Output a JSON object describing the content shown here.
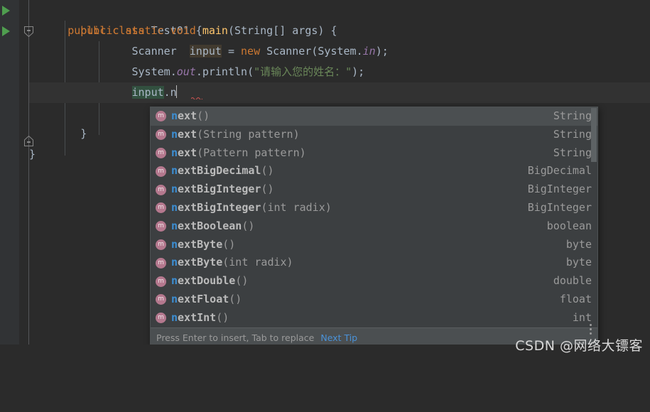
{
  "editor": {
    "lines": [
      {
        "indent": 0,
        "tokens": [
          {
            "t": "public ",
            "c": "kw"
          },
          {
            "t": "class ",
            "c": "kw"
          },
          {
            "t": "Test01",
            "c": "cls"
          },
          {
            "t": " {",
            "c": "punct"
          }
        ]
      },
      {
        "indent": 1,
        "tokens": [
          {
            "t": "public ",
            "c": "kw"
          },
          {
            "t": "static ",
            "c": "kw"
          },
          {
            "t": "void ",
            "c": "kw"
          },
          {
            "t": "main",
            "c": "fn"
          },
          {
            "t": "(",
            "c": "punct"
          },
          {
            "t": "String",
            "c": "cls"
          },
          {
            "t": "[] ",
            "c": "punct"
          },
          {
            "t": "args",
            "c": "ident"
          },
          {
            "t": ") {",
            "c": "punct"
          }
        ]
      },
      {
        "indent": 2,
        "tokens": [
          {
            "t": "Scanner ",
            "c": "cls"
          },
          {
            "t": " ",
            "c": "punct"
          },
          {
            "t": "input",
            "c": "ident hl-ident"
          },
          {
            "t": " = ",
            "c": "punct"
          },
          {
            "t": "new ",
            "c": "kw"
          },
          {
            "t": "Scanner",
            "c": "cls"
          },
          {
            "t": "(",
            "c": "punct"
          },
          {
            "t": "System",
            "c": "cls"
          },
          {
            "t": ".",
            "c": "punct"
          },
          {
            "t": "in",
            "c": "field"
          },
          {
            "t": ");",
            "c": "punct"
          }
        ]
      },
      {
        "indent": 2,
        "tokens": [
          {
            "t": "System",
            "c": "cls"
          },
          {
            "t": ".",
            "c": "punct"
          },
          {
            "t": "out",
            "c": "field"
          },
          {
            "t": ".",
            "c": "punct"
          },
          {
            "t": "println",
            "c": "ident"
          },
          {
            "t": "(",
            "c": "punct"
          },
          {
            "t": "\"请输入您的姓名：\"",
            "c": "str"
          },
          {
            "t": ");",
            "c": "punct"
          }
        ]
      },
      {
        "indent": 2,
        "tokens": [
          {
            "t": "input",
            "c": "ident hl-sel"
          },
          {
            "t": ".n",
            "c": "ident"
          }
        ]
      },
      {
        "indent": 0,
        "tokens": []
      },
      {
        "indent": 1,
        "tokens": [
          {
            "t": "}",
            "c": "punct"
          }
        ]
      },
      {
        "indent": 0,
        "tokens": [
          {
            "t": "}",
            "c": "punct"
          }
        ]
      }
    ],
    "gutter": {
      "run_arrow_rows": [
        0,
        1
      ],
      "fold_rows": [
        1,
        6
      ],
      "run_icon": "run-triangle-icon",
      "fold_icon": "fold-minus-icon"
    },
    "caret_line": 4
  },
  "completion": {
    "selected_index": 0,
    "items": [
      {
        "icon": "m",
        "match": "n",
        "name": "ext",
        "sig": "()",
        "type": "String"
      },
      {
        "icon": "m",
        "match": "n",
        "name": "ext",
        "sig": "(String pattern)",
        "type": "String"
      },
      {
        "icon": "m",
        "match": "n",
        "name": "ext",
        "sig": "(Pattern pattern)",
        "type": "String"
      },
      {
        "icon": "m",
        "match": "n",
        "name": "extBigDecimal",
        "sig": "()",
        "type": "BigDecimal"
      },
      {
        "icon": "m",
        "match": "n",
        "name": "extBigInteger",
        "sig": "()",
        "type": "BigInteger"
      },
      {
        "icon": "m",
        "match": "n",
        "name": "extBigInteger",
        "sig": "(int radix)",
        "type": "BigInteger"
      },
      {
        "icon": "m",
        "match": "n",
        "name": "extBoolean",
        "sig": "()",
        "type": "boolean"
      },
      {
        "icon": "m",
        "match": "n",
        "name": "extByte",
        "sig": "()",
        "type": "byte"
      },
      {
        "icon": "m",
        "match": "n",
        "name": "extByte",
        "sig": "(int radix)",
        "type": "byte"
      },
      {
        "icon": "m",
        "match": "n",
        "name": "extDouble",
        "sig": "()",
        "type": "double"
      },
      {
        "icon": "m",
        "match": "n",
        "name": "extFloat",
        "sig": "()",
        "type": "float"
      },
      {
        "icon": "m",
        "match": "n",
        "name": "extInt",
        "sig": "()",
        "type": "int"
      }
    ],
    "footer": {
      "hint": "Press Enter to insert, Tab to replace",
      "link": "Next Tip",
      "menu_icon": "kebab-menu-icon"
    }
  },
  "watermark": {
    "text": "CSDN @网络大镖客"
  },
  "colors": {
    "background": "#2b2b2b",
    "gutter": "#313335",
    "keyword": "#cc7832",
    "string": "#6a8759",
    "field": "#9876aa",
    "method": "#ffc66d",
    "identifier": "#a9b7c6",
    "popup_bg": "#3c3f41",
    "popup_sel": "#4b4f51",
    "match_blue": "#3d8fd4",
    "icon_pink": "#b4788e",
    "run_green": "#4f9e4f"
  }
}
